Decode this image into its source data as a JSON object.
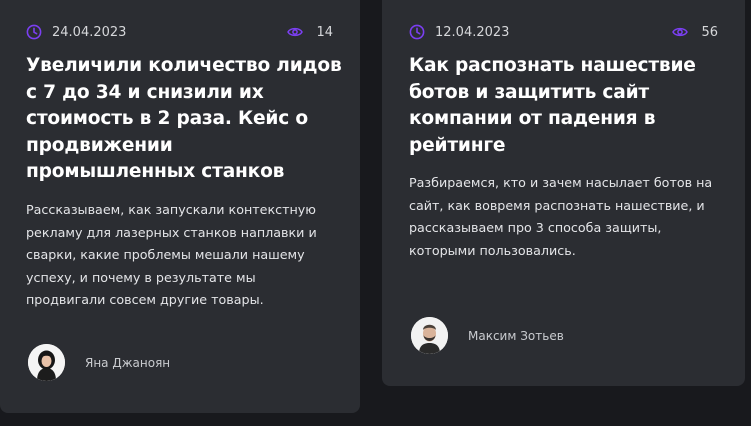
{
  "accent_color": "#7b3ff2",
  "cards": [
    {
      "date": "24.04.2023",
      "views": "14",
      "title": "Увеличили количество лидов с 7 до 34 и снизили их стоимость в 2 раза. Кейс о продвижении промышленных станков",
      "excerpt": "Рассказываем, как запускали контекстную рекламу для лазерных станков наплавки и сварки, какие проблемы мешали нашему успеху, и почему в результате мы продвигали совсем другие товары.",
      "author": "Яна Джаноян",
      "icons": {
        "date": "clock-icon",
        "views": "eye-icon"
      }
    },
    {
      "date": "12.04.2023",
      "views": "56",
      "title": "Как распознать нашествие ботов и защитить сайт компании от падения в рейтинге",
      "excerpt": "Разбираемся, кто и зачем насылает ботов на сайт, как вовремя распознать нашествие, и рассказываем про 3 способа защиты, которыми пользовались.",
      "author": "Максим Зотьев",
      "icons": {
        "date": "clock-icon",
        "views": "eye-icon"
      }
    }
  ]
}
